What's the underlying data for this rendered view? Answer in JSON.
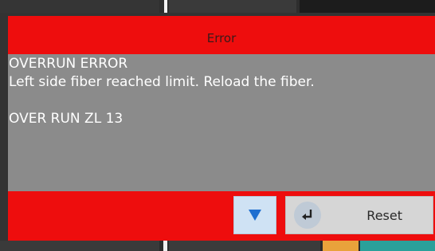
{
  "dialog": {
    "title": "Error",
    "message_lines": [
      "OVERRUN ERROR",
      "Left side fiber reached limit. Reload the fiber.",
      "",
      "OVER RUN ZL 13"
    ],
    "reset_label": "Reset",
    "icons": {
      "scroll": "down-arrow-icon",
      "reset": "enter-return-icon"
    }
  },
  "colors": {
    "header_red": "#ee0d0d",
    "body_gray": "#8b8b8b",
    "down_button_bg": "#cfe2f4",
    "arrow_blue": "#1f6fd0",
    "reset_button_bg": "#d6d6d6"
  }
}
